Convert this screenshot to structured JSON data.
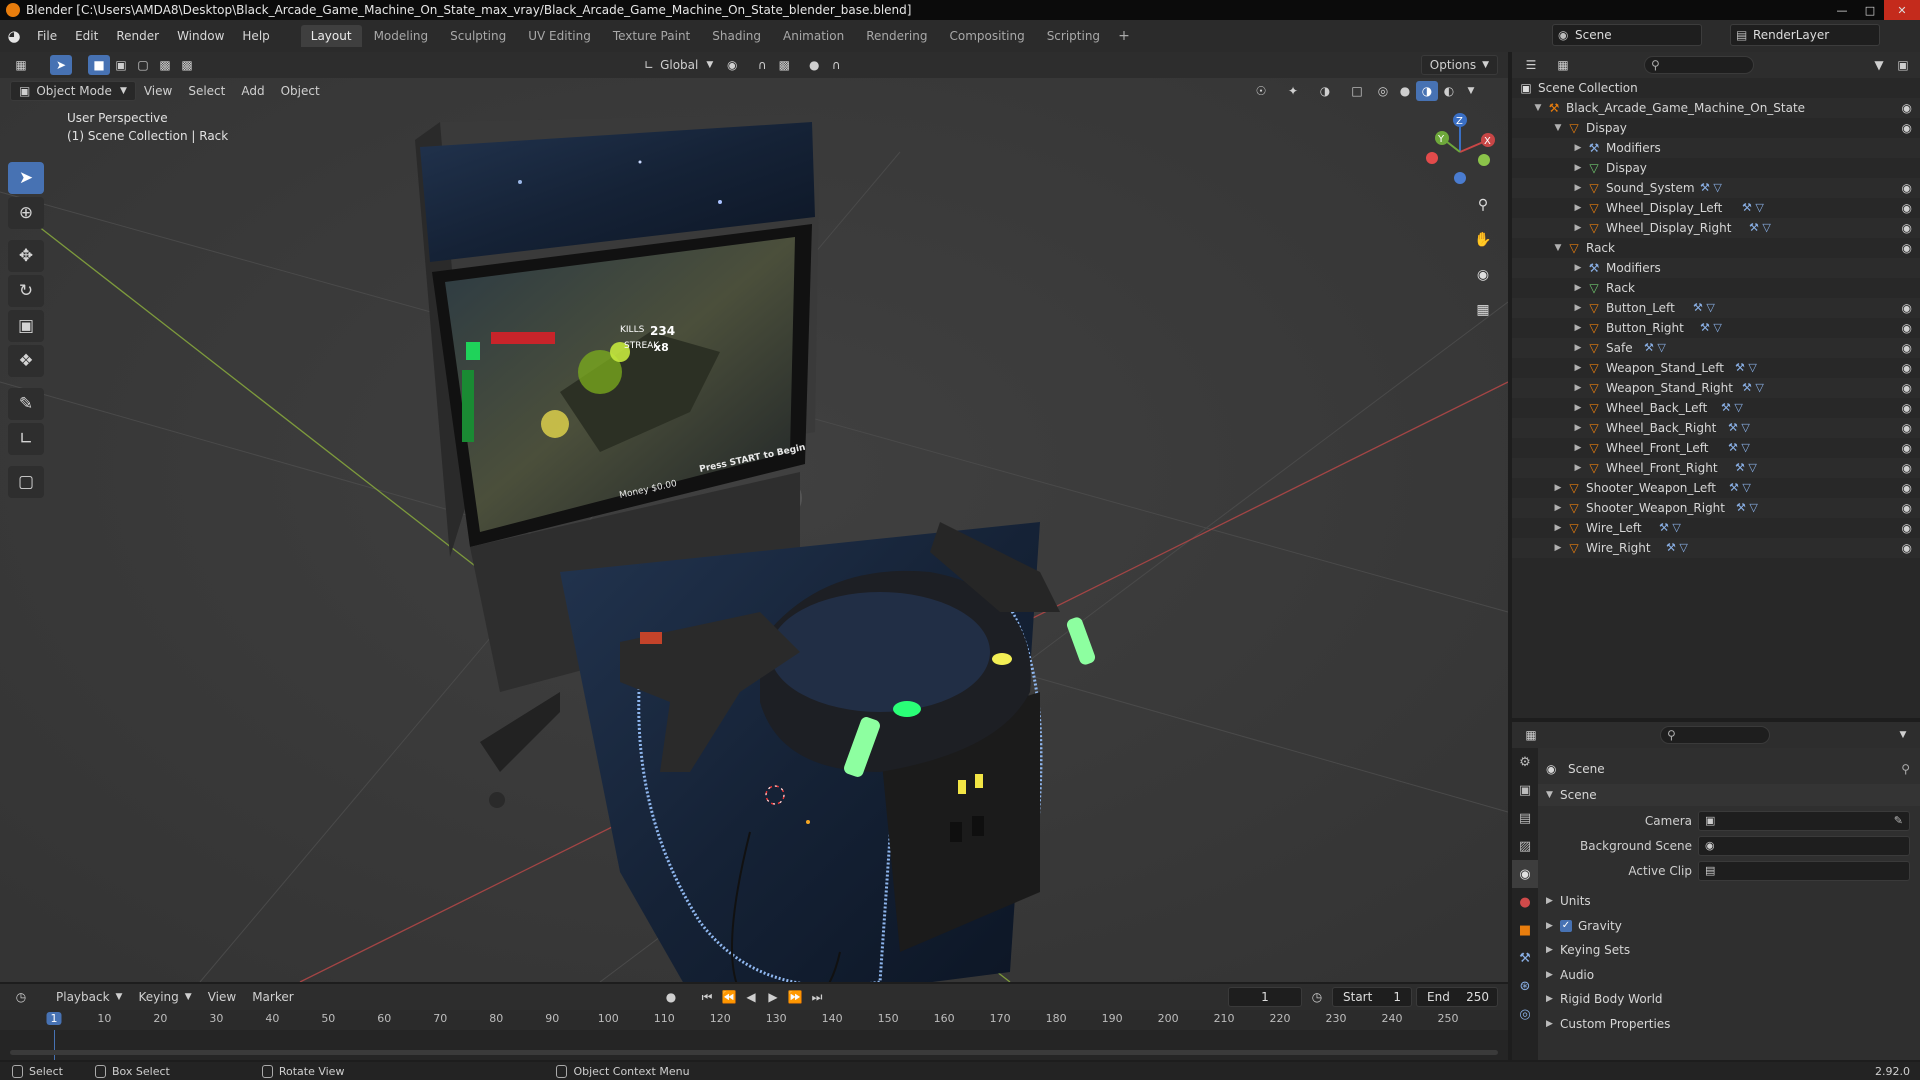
{
  "window": {
    "title": "Blender [C:\\Users\\AMDA8\\Desktop\\Black_Arcade_Game_Machine_On_State_max_vray/Black_Arcade_Game_Machine_On_State_blender_base.blend]"
  },
  "menu": [
    "File",
    "Edit",
    "Render",
    "Window",
    "Help"
  ],
  "workspaces": [
    {
      "label": "Layout",
      "active": true
    },
    {
      "label": "Modeling"
    },
    {
      "label": "Sculpting"
    },
    {
      "label": "UV Editing"
    },
    {
      "label": "Texture Paint"
    },
    {
      "label": "Shading"
    },
    {
      "label": "Animation"
    },
    {
      "label": "Rendering"
    },
    {
      "label": "Compositing"
    },
    {
      "label": "Scripting"
    }
  ],
  "scene_selector": "Scene",
  "render_layer": "RenderLayer",
  "viewport": {
    "orientation": "Global",
    "options_label": "Options",
    "mode": "Object Mode",
    "header_menus": [
      "View",
      "Select",
      "Add",
      "Object"
    ],
    "info_line1": "User Perspective",
    "info_line2": "(1) Scene Collection | Rack",
    "gizmo": {
      "x": "X",
      "y": "Y",
      "z": "Z"
    }
  },
  "outliner": {
    "root": "Scene Collection",
    "rows": [
      {
        "label": "Black_Arcade_Game_Machine_On_State",
        "depth": 0,
        "icon": "collection",
        "open": true,
        "eye": true
      },
      {
        "label": "Dispay",
        "depth": 1,
        "icon": "object",
        "open": true,
        "eye": true
      },
      {
        "label": "Modifiers",
        "depth": 2,
        "icon": "modifier",
        "eye": false
      },
      {
        "label": "Dispay",
        "depth": 2,
        "icon": "mesh",
        "eye": false
      },
      {
        "label": "Sound_System",
        "depth": 2,
        "icon": "object",
        "mods": true,
        "eye": true
      },
      {
        "label": "Wheel_Display_Left",
        "depth": 2,
        "icon": "object",
        "mods": true,
        "eye": true
      },
      {
        "label": "Wheel_Display_Right",
        "depth": 2,
        "icon": "object",
        "mods": true,
        "eye": true
      },
      {
        "label": "Rack",
        "depth": 1,
        "icon": "object",
        "open": true,
        "eye": true
      },
      {
        "label": "Modifiers",
        "depth": 2,
        "icon": "modifier",
        "eye": false
      },
      {
        "label": "Rack",
        "depth": 2,
        "icon": "mesh",
        "eye": false
      },
      {
        "label": "Button_Left",
        "depth": 2,
        "icon": "object",
        "mods": true,
        "eye": true
      },
      {
        "label": "Button_Right",
        "depth": 2,
        "icon": "object",
        "mods": true,
        "eye": true
      },
      {
        "label": "Safe",
        "depth": 2,
        "icon": "object",
        "mods": true,
        "eye": true
      },
      {
        "label": "Weapon_Stand_Left",
        "depth": 2,
        "icon": "object",
        "mods": true,
        "eye": true
      },
      {
        "label": "Weapon_Stand_Right",
        "depth": 2,
        "icon": "object",
        "mods": true,
        "eye": true
      },
      {
        "label": "Wheel_Back_Left",
        "depth": 2,
        "icon": "object",
        "mods": true,
        "eye": true
      },
      {
        "label": "Wheel_Back_Right",
        "depth": 2,
        "icon": "object",
        "mods": true,
        "eye": true
      },
      {
        "label": "Wheel_Front_Left",
        "depth": 2,
        "icon": "object",
        "mods": true,
        "eye": true
      },
      {
        "label": "Wheel_Front_Right",
        "depth": 2,
        "icon": "object",
        "mods": true,
        "eye": true
      },
      {
        "label": "Shooter_Weapon_Left",
        "depth": 1,
        "icon": "object",
        "mods": true,
        "eye": true
      },
      {
        "label": "Shooter_Weapon_Right",
        "depth": 1,
        "icon": "object",
        "mods": true,
        "eye": true
      },
      {
        "label": "Wire_Left",
        "depth": 1,
        "icon": "object",
        "mods": true,
        "eye": true
      },
      {
        "label": "Wire_Right",
        "depth": 1,
        "icon": "object",
        "mods": true,
        "eye": true
      }
    ]
  },
  "properties": {
    "context": "Scene",
    "panel": "Scene",
    "fields": [
      {
        "label": "Camera",
        "value": ""
      },
      {
        "label": "Background Scene",
        "value": ""
      },
      {
        "label": "Active Clip",
        "value": ""
      }
    ],
    "subpanels": [
      {
        "label": "Units"
      },
      {
        "label": "Gravity",
        "checkbox": true
      },
      {
        "label": "Keying Sets"
      },
      {
        "label": "Audio"
      },
      {
        "label": "Rigid Body World"
      },
      {
        "label": "Custom Properties"
      }
    ]
  },
  "timeline": {
    "menus": [
      "Playback",
      "Keying",
      "View",
      "Marker"
    ],
    "current_frame": "1",
    "start_label": "Start",
    "start": "1",
    "end_label": "End",
    "end": "250",
    "ticks": [
      "1",
      "10",
      "20",
      "30",
      "40",
      "50",
      "60",
      "70",
      "80",
      "90",
      "100",
      "110",
      "120",
      "130",
      "140",
      "150",
      "160",
      "170",
      "180",
      "190",
      "200",
      "210",
      "220",
      "230",
      "240",
      "250"
    ]
  },
  "statusbar": {
    "select": "Select",
    "box_select": "Box Select",
    "rotate_view": "Rotate View",
    "context_menu": "Object Context Menu",
    "version": "2.92.0"
  },
  "game_screen": {
    "kills_label": "KILLS",
    "kills": "234",
    "streak_label": "STREAK",
    "streak": "x8",
    "money": "Money $0.00",
    "press_start": "Press START to Begin"
  },
  "colors": {
    "accent": "#4772b3",
    "object_icon": "#e87d0d",
    "mesh_icon": "#6ec66e",
    "modifier_icon": "#8ab0e6"
  }
}
